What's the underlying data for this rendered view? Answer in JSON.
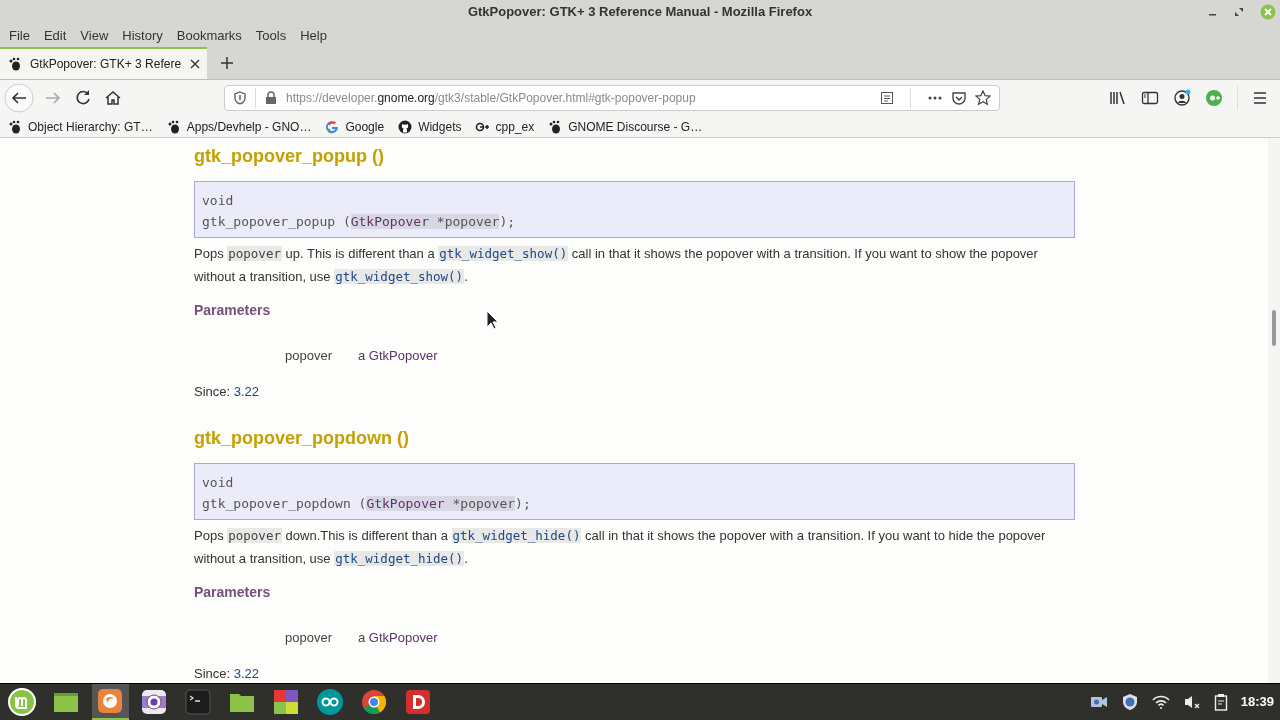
{
  "window": {
    "title": "GtkPopover: GTK+ 3 Reference Manual - Mozilla Firefox"
  },
  "menu": [
    "File",
    "Edit",
    "View",
    "History",
    "Bookmarks",
    "Tools",
    "Help"
  ],
  "tabs": [
    {
      "label": "GtkPopover: GTK+ 3 Refere",
      "selected": true
    }
  ],
  "url": {
    "prefix": "https://developer.",
    "domain": "gnome.org",
    "path": "/gtk3/stable/GtkPopover.html#gtk-popover-popup"
  },
  "bookmarks": [
    {
      "label": "Object Hierarchy: GT…",
      "kind": "gnome"
    },
    {
      "label": "Apps/Devhelp - GNO…",
      "kind": "gnome"
    },
    {
      "label": "Google",
      "kind": "google"
    },
    {
      "label": "Widgets",
      "kind": "github"
    },
    {
      "label": "cpp_ex",
      "kind": "gplus"
    },
    {
      "label": "GNOME Discourse - G…",
      "kind": "gnome"
    }
  ],
  "sections": [
    {
      "heading": "gtk_popover_popup ()",
      "signature": {
        "return_type": "void",
        "function": "gtk_popover_popup (",
        "arg_type": "GtkPopover",
        "arg_name": " *popover",
        "end": ");"
      },
      "description": [
        {
          "kind": "text",
          "text": "Pops "
        },
        {
          "kind": "code",
          "text": "popover"
        },
        {
          "kind": "text",
          "text": " up. This is different than a "
        },
        {
          "kind": "code_link",
          "text": "gtk_widget_show()"
        },
        {
          "kind": "text",
          "text": " call in that it shows the popover with a transition. If you want to show the popover without a transition, use "
        },
        {
          "kind": "code_link",
          "text": "gtk_widget_show()"
        },
        {
          "kind": "text",
          "text": "."
        }
      ],
      "parameters_heading": "Parameters",
      "parameters": [
        {
          "name": "popover",
          "prefix": "a ",
          "type": "GtkPopover"
        }
      ],
      "since_label": "Since: ",
      "since": "3.22"
    },
    {
      "heading": "gtk_popover_popdown ()",
      "signature": {
        "return_type": "void",
        "function": "gtk_popover_popdown (",
        "arg_type": "GtkPopover",
        "arg_name": " *popover",
        "end": ");"
      },
      "description": [
        {
          "kind": "text",
          "text": "Pops "
        },
        {
          "kind": "code",
          "text": "popover"
        },
        {
          "kind": "text",
          "text": " down.This is different than a "
        },
        {
          "kind": "code_link",
          "text": "gtk_widget_hide()"
        },
        {
          "kind": "text",
          "text": " call in that it shows the popover with a transition. If you want to hide the popover without a transition, use "
        },
        {
          "kind": "code_link",
          "text": "gtk_widget_hide()"
        },
        {
          "kind": "text",
          "text": "."
        }
      ],
      "parameters_heading": "Parameters",
      "parameters": [
        {
          "name": "popover",
          "prefix": "a ",
          "type": "GtkPopover"
        }
      ],
      "since_label": "Since: ",
      "since": "3.22"
    }
  ],
  "taskbar": [
    {
      "kind": "mint",
      "active": false
    },
    {
      "kind": "desktop",
      "active": false
    },
    {
      "kind": "firefox",
      "active": true
    },
    {
      "kind": "camera",
      "active": false
    },
    {
      "kind": "terminal",
      "active": false
    },
    {
      "kind": "folder",
      "active": false
    },
    {
      "kind": "grid",
      "active": false
    },
    {
      "kind": "arduino",
      "active": false
    },
    {
      "kind": "chrome",
      "active": false
    },
    {
      "kind": "d",
      "active": false
    }
  ],
  "clock": "18:39"
}
